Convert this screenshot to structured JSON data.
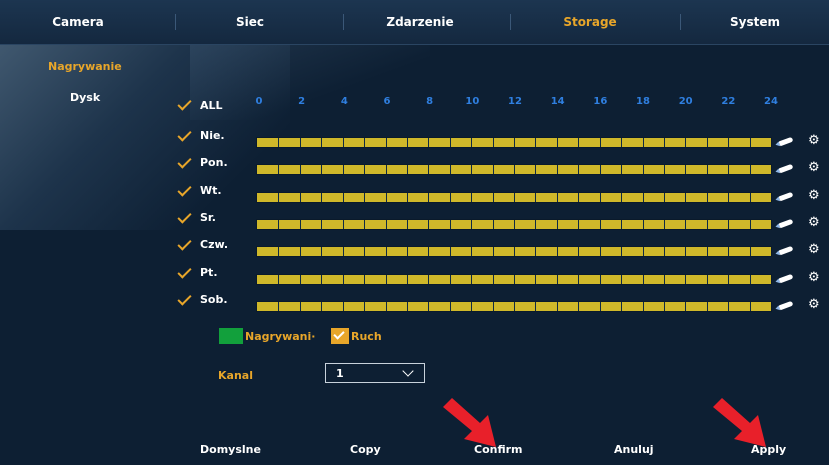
{
  "tabs": [
    {
      "label": "Camera",
      "active": false
    },
    {
      "label": "Siec",
      "active": false
    },
    {
      "label": "Zdarzenie",
      "active": false
    },
    {
      "label": "Storage",
      "active": true
    },
    {
      "label": "System",
      "active": false
    }
  ],
  "sidebar": {
    "items": [
      {
        "label": "Nagrywanie",
        "active": true
      },
      {
        "label": "Dysk",
        "active": false
      }
    ]
  },
  "schedule": {
    "all_label": "ALL",
    "hours": [
      "0",
      "2",
      "4",
      "6",
      "8",
      "10",
      "12",
      "14",
      "16",
      "18",
      "20",
      "22",
      "24"
    ],
    "days": [
      {
        "label": "Nie.",
        "checked": true,
        "fill_fraction": 1.0
      },
      {
        "label": "Pon.",
        "checked": true,
        "fill_fraction": 1.0
      },
      {
        "label": "Wt.",
        "checked": true,
        "fill_fraction": 1.0
      },
      {
        "label": "Sr.",
        "checked": true,
        "fill_fraction": 1.0
      },
      {
        "label": "Czw.",
        "checked": true,
        "fill_fraction": 1.0
      },
      {
        "label": "Pt.",
        "checked": true,
        "fill_fraction": 1.0
      },
      {
        "label": "Sob.",
        "checked": true,
        "fill_fraction": 1.0
      }
    ]
  },
  "legend": {
    "record_label": "Nagrywani·",
    "motion_label": "Ruch"
  },
  "channel": {
    "label": "Kanal",
    "value": "1"
  },
  "buttons": {
    "default": "Domyslne",
    "copy": "Copy",
    "confirm": "Confirm",
    "cancel": "Anuluj",
    "apply": "Apply"
  },
  "colors": {
    "accent": "#e8a62a",
    "record": "#12a03c",
    "motion": "#cfb82a",
    "hour_labels": "#2f7fe0",
    "arrows": "#e8202a"
  }
}
